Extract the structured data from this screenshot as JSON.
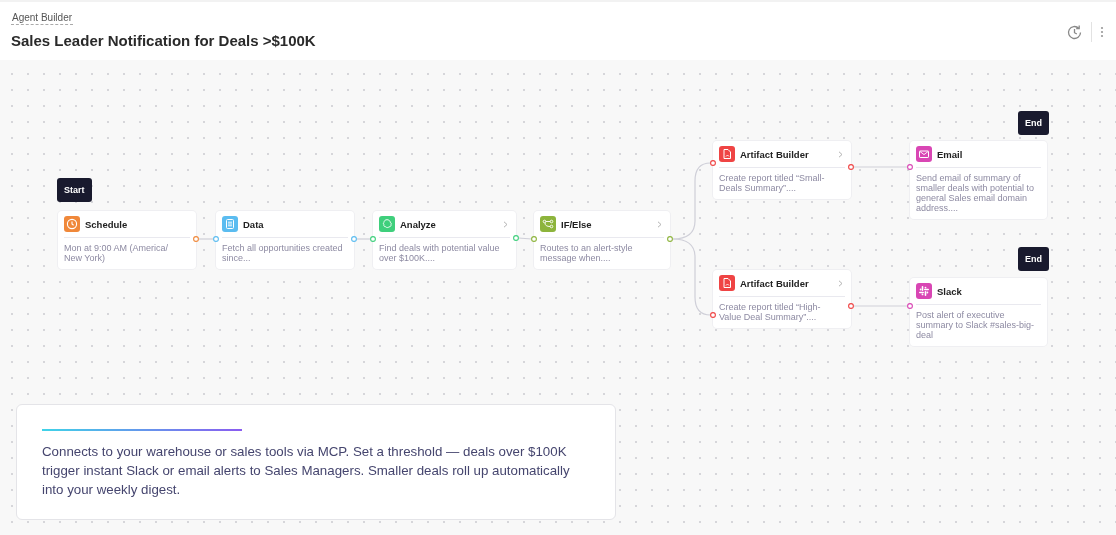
{
  "header": {
    "breadcrumb": "Agent Builder",
    "title": "Sales Leader Notification for Deals >$100K"
  },
  "nodes": [
    {
      "kind": "start",
      "label": "Start"
    },
    {
      "kind": "schedule",
      "label": "Schedule",
      "description": "Mon at 9:00 AM (America/ New York)",
      "color": "#f0883a",
      "expandable": false
    },
    {
      "kind": "data",
      "label": "Data",
      "description": "Fetch all opportunities created since...",
      "color": "#5bbcf0",
      "expandable": false
    },
    {
      "kind": "analyze",
      "label": "Analyze",
      "description": "Find deals with potential value over $100K....",
      "color": "#3fcf7c",
      "expandable": true
    },
    {
      "kind": "condition",
      "label": "IF/Else",
      "description": "Routes to an alert-style message when....",
      "color": "#8db43c",
      "expandable": true
    },
    {
      "kind": "artifact",
      "label": "Artifact Builder",
      "description": "Create report titled “Small-Deals Summary”....",
      "color": "#ef4444",
      "expandable": true
    },
    {
      "kind": "end",
      "label": "End"
    },
    {
      "kind": "email",
      "label": "Email",
      "description": "Send email of summary of smaller deals with potential to general Sales email domain address....",
      "color": "#d946b4",
      "expandable": false
    },
    {
      "kind": "artifact",
      "label": "Artifact Builder",
      "description": "Create report titled “High-Value Deal Summary”....",
      "color": "#ef4444",
      "expandable": true
    },
    {
      "kind": "end",
      "label": "End"
    },
    {
      "kind": "slack",
      "label": "Slack",
      "description": "Post alert of executive summary to Slack #sales-big-deal",
      "color": "#d946b4",
      "expandable": false
    }
  ],
  "description": "Connects to your warehouse or sales tools via MCP. Set a threshold — deals over $100K trigger instant Slack or email alerts to Sales Managers. Smaller deals roll up automatically into your weekly digest."
}
